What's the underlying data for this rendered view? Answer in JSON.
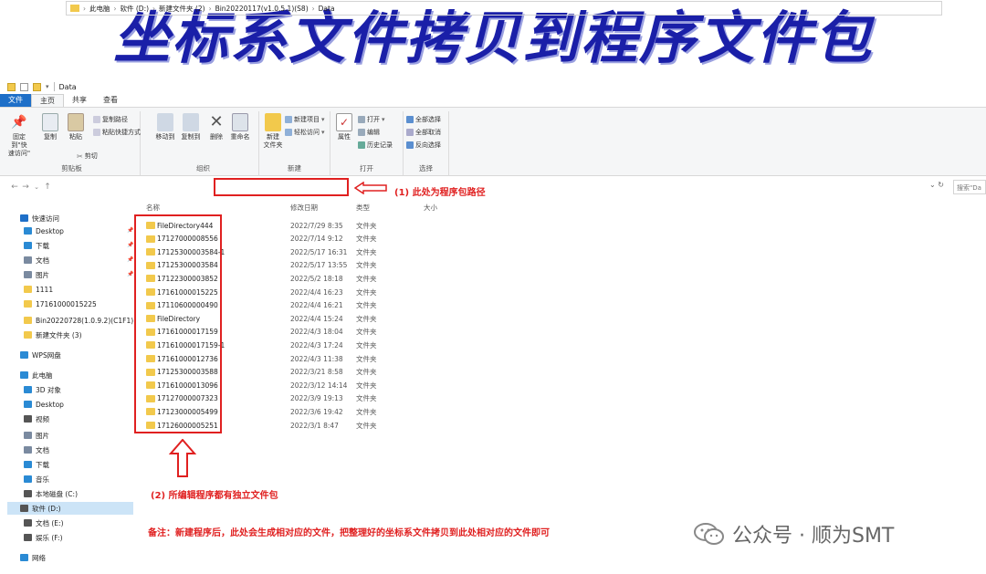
{
  "banner": {
    "title": "坐标系文件拷贝到程序文件包"
  },
  "window": {
    "title": "Data"
  },
  "ribbon_tabs": [
    "文件",
    "主页",
    "共享",
    "查看"
  ],
  "ribbon": {
    "clipboard": {
      "pin": "固定到\"快\n速访问\"",
      "copy": "复制",
      "paste": "粘贴",
      "copy_path": "复制路径",
      "paste_shortcut": "粘贴快捷方式",
      "cut": "剪切",
      "label": "剪贴板"
    },
    "organize": {
      "move_to": "移动到",
      "copy_to": "复制到",
      "delete": "删除",
      "rename": "重命名",
      "label": "组织"
    },
    "new": {
      "new_folder": "新建\n文件夹",
      "new_item": "新建项目",
      "easy_access": "轻松访问",
      "label": "新建"
    },
    "open": {
      "properties": "属性",
      "open": "打开",
      "edit": "编辑",
      "history": "历史记录",
      "label": "打开"
    },
    "select": {
      "select_all": "全部选择",
      "select_none": "全部取消",
      "invert": "反向选择",
      "label": "选择"
    }
  },
  "address": {
    "crumbs": [
      "此电脑",
      "软件 (D:)",
      "新建文件夹 (2)",
      "Bin20220117(v1.0.5.1)(S8)",
      "Data"
    ],
    "search_placeholder": "搜索\"Da"
  },
  "annotations": {
    "a1": "(1)  此处为程序包路径",
    "a2": "(2)  所编辑程序都有独立文件包",
    "a3": "备注：新建程序后，此处会生成相对应的文件，把整理好的坐标系文件拷贝到此处相对应的文件即可"
  },
  "columns": {
    "name": "名称",
    "date": "修改日期",
    "type": "类型",
    "size": "大小"
  },
  "nav": [
    {
      "label": "快速访问",
      "icon": "star-icon",
      "color": "#1e6fc8"
    },
    {
      "label": "Desktop",
      "icon": "desktop-icon",
      "color": "#2a8ad4"
    },
    {
      "label": "下载",
      "icon": "download-icon",
      "color": "#2a8ad4"
    },
    {
      "label": "文档",
      "icon": "document-icon",
      "color": "#7a8aa0"
    },
    {
      "label": "图片",
      "icon": "picture-icon",
      "color": "#7a8aa0"
    },
    {
      "label": "1111",
      "icon": "folder-icon",
      "color": "#f2c94c"
    },
    {
      "label": "17161000015225",
      "icon": "folder-icon",
      "color": "#f2c94c"
    },
    {
      "label": "Bin20220728(1.0.9.2)(C1F1)",
      "icon": "folder-icon",
      "color": "#f2c94c"
    },
    {
      "label": "新建文件夹 (3)",
      "icon": "folder-icon",
      "color": "#f2c94c"
    },
    {
      "label": "WPS网盘",
      "icon": "cloud-icon",
      "color": "#2a8ad4"
    },
    {
      "label": "此电脑",
      "icon": "computer-icon",
      "color": "#2a8ad4"
    },
    {
      "label": "3D 对象",
      "icon": "cube-icon",
      "color": "#2a8ad4"
    },
    {
      "label": "Desktop",
      "icon": "desktop-icon",
      "color": "#2a8ad4"
    },
    {
      "label": "视频",
      "icon": "video-icon",
      "color": "#555"
    },
    {
      "label": "图片",
      "icon": "picture-icon",
      "color": "#7a8aa0"
    },
    {
      "label": "文档",
      "icon": "document-icon",
      "color": "#7a8aa0"
    },
    {
      "label": "下载",
      "icon": "download-icon",
      "color": "#2a8ad4"
    },
    {
      "label": "音乐",
      "icon": "music-icon",
      "color": "#2a8ad4"
    },
    {
      "label": "本地磁盘 (C:)",
      "icon": "drive-icon",
      "color": "#555"
    },
    {
      "label": "软件 (D:)",
      "icon": "drive-icon",
      "color": "#555"
    },
    {
      "label": "文档 (E:)",
      "icon": "drive-icon",
      "color": "#555"
    },
    {
      "label": "娱乐 (F:)",
      "icon": "drive-icon",
      "color": "#555"
    },
    {
      "label": "网络",
      "icon": "network-icon",
      "color": "#2a8ad4"
    }
  ],
  "files": [
    {
      "name": "FileDirectory444",
      "date": "2022/7/29 8:35",
      "type": "文件夹"
    },
    {
      "name": "17127000008556",
      "date": "2022/7/14 9:12",
      "type": "文件夹"
    },
    {
      "name": "17125300003584-1",
      "date": "2022/5/17 16:31",
      "type": "文件夹"
    },
    {
      "name": "17125300003584",
      "date": "2022/5/17 13:55",
      "type": "文件夹"
    },
    {
      "name": "17122300003852",
      "date": "2022/5/2 18:18",
      "type": "文件夹"
    },
    {
      "name": "17161000015225",
      "date": "2022/4/4 16:23",
      "type": "文件夹"
    },
    {
      "name": "17110600000490",
      "date": "2022/4/4 16:21",
      "type": "文件夹"
    },
    {
      "name": "FileDirectory",
      "date": "2022/4/4 15:24",
      "type": "文件夹"
    },
    {
      "name": "17161000017159",
      "date": "2022/4/3 18:04",
      "type": "文件夹"
    },
    {
      "name": "17161000017159-1",
      "date": "2022/4/3 17:24",
      "type": "文件夹"
    },
    {
      "name": "17161000012736",
      "date": "2022/4/3 11:38",
      "type": "文件夹"
    },
    {
      "name": "17125300003588",
      "date": "2022/3/21 8:58",
      "type": "文件夹"
    },
    {
      "name": "17161000013096",
      "date": "2022/3/12 14:14",
      "type": "文件夹"
    },
    {
      "name": "17127000007323",
      "date": "2022/3/9 19:13",
      "type": "文件夹"
    },
    {
      "name": "17123000005499",
      "date": "2022/3/6 19:42",
      "type": "文件夹"
    },
    {
      "name": "17126000005251",
      "date": "2022/3/1 8:47",
      "type": "文件夹"
    }
  ],
  "watermark": {
    "text": "公众号 · 顺为SMT"
  },
  "colors": {
    "accent": "#1e6fc8",
    "annotation_red": "#e02020",
    "banner_blue": "#1a1fa8",
    "folder_yellow": "#f2c94c"
  }
}
